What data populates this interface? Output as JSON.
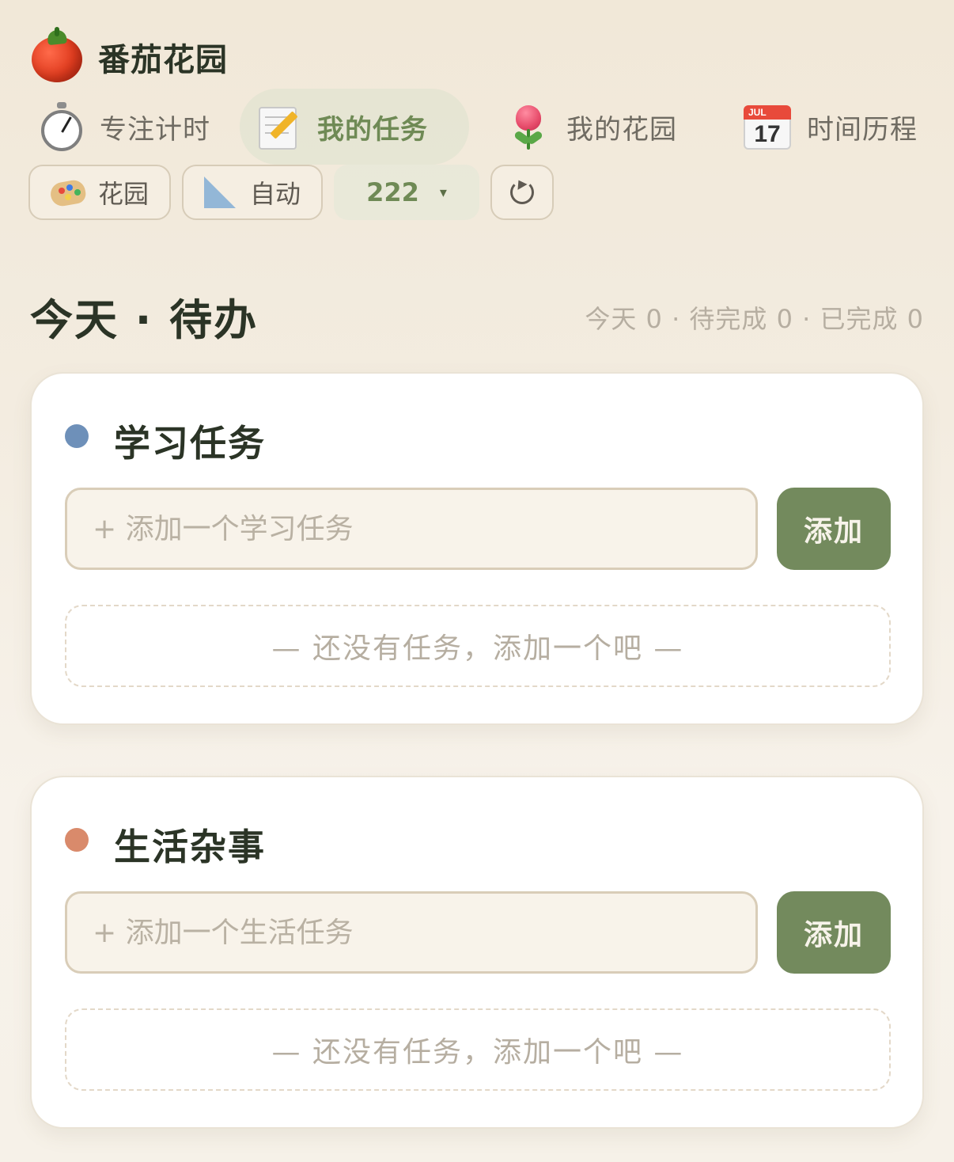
{
  "app": {
    "title": "番茄花园"
  },
  "nav": {
    "items": [
      {
        "label": "专注计时",
        "icon": "stopwatch-icon",
        "active": false
      },
      {
        "label": "我的任务",
        "icon": "memo-pencil-icon",
        "active": true
      },
      {
        "label": "我的花园",
        "icon": "tulip-icon",
        "active": false
      },
      {
        "label": "时间历程",
        "icon": "calendar-icon",
        "active": false
      }
    ]
  },
  "calendar_icon": {
    "month": "JUL",
    "day": "17"
  },
  "controls": {
    "garden_label": "花园",
    "garden_icon": "palette-icon",
    "auto_label": "自动",
    "auto_icon": "triangle-ruler-icon",
    "selector_value": "222",
    "selector_caret": "▾",
    "reset_icon": "reset-icon"
  },
  "today": {
    "title": "今天 · 待办",
    "summary": "今天 0 · 待完成 0 · 已完成 0"
  },
  "sections": [
    {
      "title": "学习任务",
      "dot_color": "#6e90b9",
      "placeholder": "+ 添加一个学习任务",
      "add_label": "添加",
      "empty_text": "— 还没有任务，添加一个吧 —"
    },
    {
      "title": "生活杂事",
      "dot_color": "#d98a6b",
      "placeholder": "+ 添加一个生活任务",
      "add_label": "添加",
      "empty_text": "— 还没有任务，添加一个吧 —"
    }
  ],
  "colors": {
    "accent_green": "#738a5d",
    "text_dark": "#2b3426",
    "muted": "#b6aea1",
    "card_bg": "#ffffff",
    "page_bg": "#f3ece0"
  }
}
